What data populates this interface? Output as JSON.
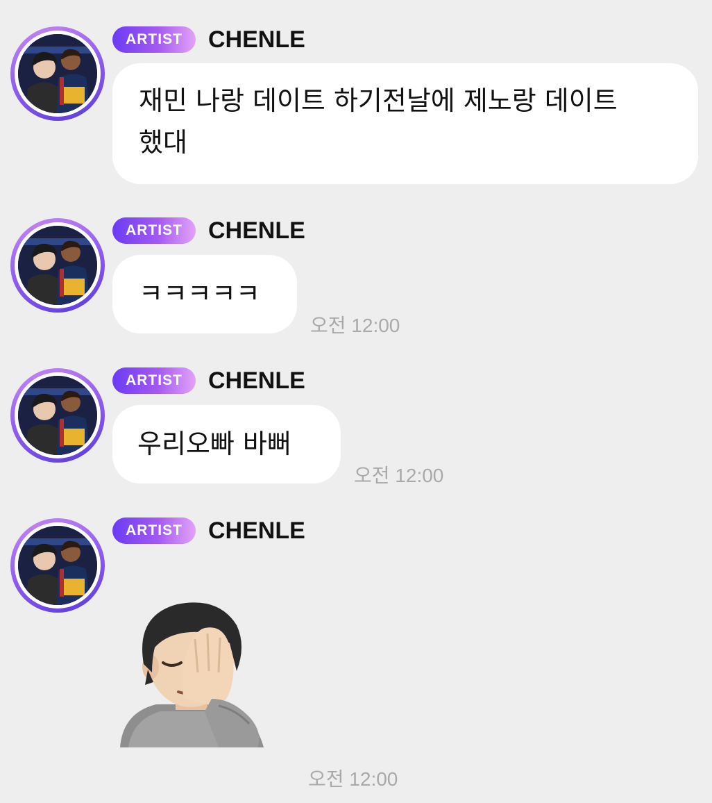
{
  "messages": [
    {
      "badge": "ARTIST",
      "sender": "CHENLE",
      "text_line1": "재민 나랑 데이트 하기전날에 제노랑 데이트",
      "text_line2": "했대"
    },
    {
      "badge": "ARTIST",
      "sender": "CHENLE",
      "text": "ㅋㅋㅋㅋㅋ",
      "time": "오전 12:00"
    },
    {
      "badge": "ARTIST",
      "sender": "CHENLE",
      "text": "우리오빠 바뻐",
      "time": "오전 12:00"
    },
    {
      "badge": "ARTIST",
      "sender": "CHENLE",
      "emoji": "face-palm-emoji",
      "time": "오전 12:00"
    }
  ],
  "icons": {
    "avatar": "profile-photo",
    "sticker": "person-facepalming-emoji"
  },
  "colors": {
    "background": "#eeeeee",
    "bubble": "#ffffff",
    "badge_start": "#6a3cf4",
    "badge_end": "#e2a3f7",
    "avatar_ring": "#8f5cf0",
    "timestamp": "#a9a9a9"
  }
}
